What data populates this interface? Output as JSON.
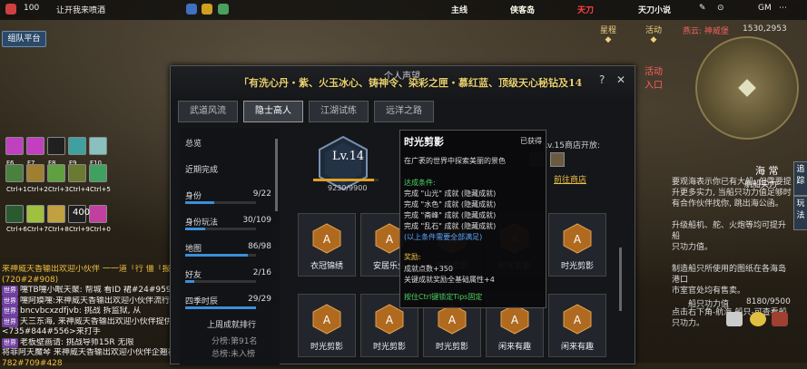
{
  "status_bar": {
    "battery": "100",
    "notice": "让开我来喷酒",
    "main_line": "主线",
    "logo1": "侠客岛",
    "logo2": "天刀",
    "logo3": "天刀小说",
    "gm": "GM"
  },
  "left": {
    "team_button": "组队平台",
    "skills_row1": [
      "F6",
      "F7",
      "F8",
      "F9",
      "F10"
    ],
    "skills_row2": [
      "Ctrl+1",
      "Ctrl+2",
      "Ctrl+3",
      "Ctrl+4",
      "Ctrl+5"
    ],
    "skills_row3": [
      "Ctrl+6",
      "Ctrl+7",
      "Ctrl+8",
      "Ctrl+9",
      "Ctrl+0"
    ],
    "skill_count": "400"
  },
  "chat": [
    {
      "text": "来神威天香输出欢迎小伙伴 一一道「行 僵「报一企",
      "color": "#f0c040"
    },
    {
      "text": "(720#2#908)",
      "color": "#f0c040"
    },
    {
      "tag": "世界",
      "text": "嚏TB嚏小眠天聚: 帮城 看ID 裙#24#959",
      "color": "#eee"
    },
    {
      "tag": "世界",
      "text": "嚏阿嫫嚏:来神威天香输出欢迎小伙伴流行通知",
      "color": "#eee"
    },
    {
      "tag": "世界",
      "text": "bncvbcxzdfjvb: 挑战 拆监狱, 从",
      "color": "#eee"
    },
    {
      "tag": "世界",
      "text": "天三东海, 来神威天香输出欢迎小伙伴提供",
      "color": "#eee"
    },
    {
      "text": "<735#844#556>来打手",
      "color": "#eee"
    },
    {
      "tag": "世界",
      "text": "老板壁画请: 挑战导师15R 无限",
      "color": "#eee"
    },
    {
      "text": "将菲阿天魔琴 来神威天香输出欢迎小伙伴企翘裙",
      "color": "#eee"
    },
    {
      "text": "782#709#428",
      "color": "#f0c040"
    }
  ],
  "panel": {
    "banner": "「有洗心丹・紫、火玉冰心、铸神令、染彩之匣・慕红蓝、顶级天心秘钻及14",
    "title": "个人声望",
    "help": "?",
    "close": "✕",
    "tabs": [
      "武道风流",
      "隐士高人",
      "江湖试练",
      "远洋之路"
    ],
    "active_tab": 1,
    "sidebar": [
      {
        "label": "总览",
        "value": "",
        "fill": 0
      },
      {
        "label": "近期完成",
        "value": "",
        "fill": 0
      },
      {
        "label": "身份",
        "value": "9/22",
        "fill": 0.41
      },
      {
        "label": "身份玩法",
        "value": "30/109",
        "fill": 0.28
      },
      {
        "label": "地图",
        "value": "86/98",
        "fill": 0.88
      },
      {
        "label": "好友",
        "value": "2/16",
        "fill": 0.13
      },
      {
        "label": "四季时辰",
        "value": "29/29",
        "fill": 1.0
      }
    ],
    "rank_title": "上周成就排行",
    "rank_line1": "分榜:第91名",
    "rank_line2": "总榜:未入榜",
    "level": "Lv.14",
    "xp": "9230/9900",
    "xp_fraction": 0.93,
    "shop_label": "Lv.15商店开放:",
    "shop_link": "前往商店",
    "cards": [
      {
        "label": "衣冠锦绣"
      },
      {
        "label": "安居乐业"
      },
      {
        "label": "时光剪影"
      },
      {
        "label": "时光剪影"
      },
      {
        "label": "时光剪影"
      },
      {
        "label": "时光剪影"
      },
      {
        "label": "时光剪影"
      },
      {
        "label": "时光剪影"
      },
      {
        "label": "闲来有趣"
      },
      {
        "label": "闲来有趣"
      }
    ]
  },
  "tooltip": {
    "title": "时光剪影",
    "status": "已获得",
    "desc": "在广袤的世界中探索美丽的景色",
    "cond_title": "达成条件:",
    "cond": [
      "完成 \"山光\" 成就 (隐藏成就)",
      "完成 \"水色\" 成就 (隐藏成就)",
      "完成 \"斋峰\" 成就 (隐藏成就)",
      "完成 \"乱石\" 成就 (隐藏成就)"
    ],
    "cond_note": "(以上条件需要全部满足)",
    "reward_title": "奖励:",
    "reward1": "成就点数+350",
    "reward2": "关键成就奖励全基础属性+4",
    "hint": "按住Ctrl键锁定Tips固定"
  },
  "right": {
    "location": "燕云: 神威堡",
    "coords": "1530,2953",
    "quest_title": "航船实力",
    "quest_tag": "海 常",
    "quest_text": [
      "要观海表示你已有大船, 但需要提",
      "升更多实力, 当船只功力值足够时",
      "有合作伙伴找你, 跳出海公函。",
      "",
      "升级船机、舵、火炮等均可提升船",
      "只功力值。",
      "",
      "制造船只所使用的图纸在各海岛港口",
      "市室官处均有售卖。",
      "",
      "点击右下角-航海-船只-可查看船",
      "只功力。"
    ],
    "power_label": "船只功力值",
    "power_value": "8180/9500",
    "side_tabs": [
      "追踪",
      "玩法"
    ]
  }
}
